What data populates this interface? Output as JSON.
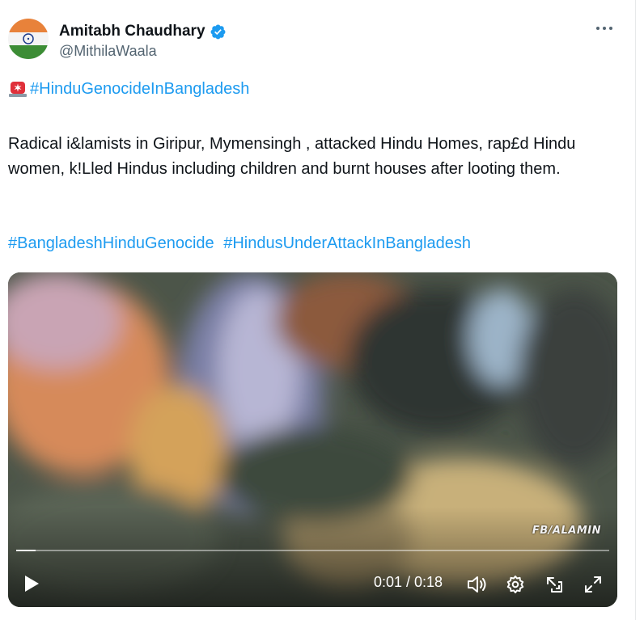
{
  "tweet": {
    "author": {
      "display_name": "Amitabh Chaudhary",
      "handle": "@MithilaWaala",
      "avatar_icon": "india-flag-avatar",
      "verified_icon": "verified-badge-icon"
    },
    "more_icon": "more-options-icon",
    "headline": {
      "emoji_icon": "rotating-siren-icon",
      "hashtag": "#HinduGenocideInBangladesh"
    },
    "body": "Radical i&lamists in Giripur, Mymensingh , attacked Hindu Homes, rap£d Hindu women, k!Lled Hindus including children and burnt houses after looting them.",
    "hashtags": [
      "#BangladeshHinduGenocide",
      "#HindusUnderAttackInBangladesh"
    ],
    "video": {
      "watermark": "FB/ALAMIN",
      "progress": 0.033,
      "time_display": "0:01 / 0:18",
      "controls": [
        "play-icon",
        "volume-icon",
        "settings-icon",
        "pop-out-icon",
        "fullscreen-icon"
      ]
    }
  },
  "colors": {
    "link": "#1d9bf0",
    "text": "#0f1419",
    "muted": "#536471",
    "verified": "#1d9bf0"
  }
}
